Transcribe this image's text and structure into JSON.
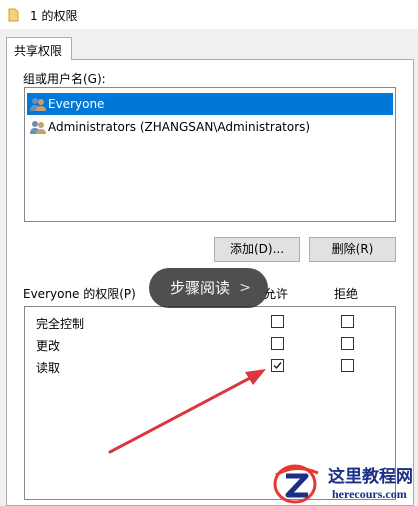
{
  "window": {
    "title": "1 的权限"
  },
  "tabs": [
    {
      "label": "共享权限"
    }
  ],
  "users": {
    "label": "组或用户名(G):",
    "items": [
      {
        "name": "Everyone",
        "selected": true
      },
      {
        "name": "Administrators (ZHANGSAN\\Administrators)",
        "selected": false
      }
    ]
  },
  "buttons": {
    "add": "添加(D)...",
    "remove": "删除(R)"
  },
  "permissions": {
    "title": "Everyone 的权限(P)",
    "col_allow": "允许",
    "col_deny": "拒绝",
    "rows": [
      {
        "name": "完全控制",
        "allow": false,
        "deny": false
      },
      {
        "name": "更改",
        "allow": false,
        "deny": false
      },
      {
        "name": "读取",
        "allow": true,
        "deny": false
      }
    ]
  },
  "overlay": {
    "step_reading": "步骤阅读",
    "chevron": ">"
  },
  "watermark": {
    "name": "这里教程网",
    "url": "herecours.com"
  },
  "colors": {
    "selection": "#0078d7",
    "arrow": "#d9363e",
    "watermark": "#1b2f86"
  }
}
